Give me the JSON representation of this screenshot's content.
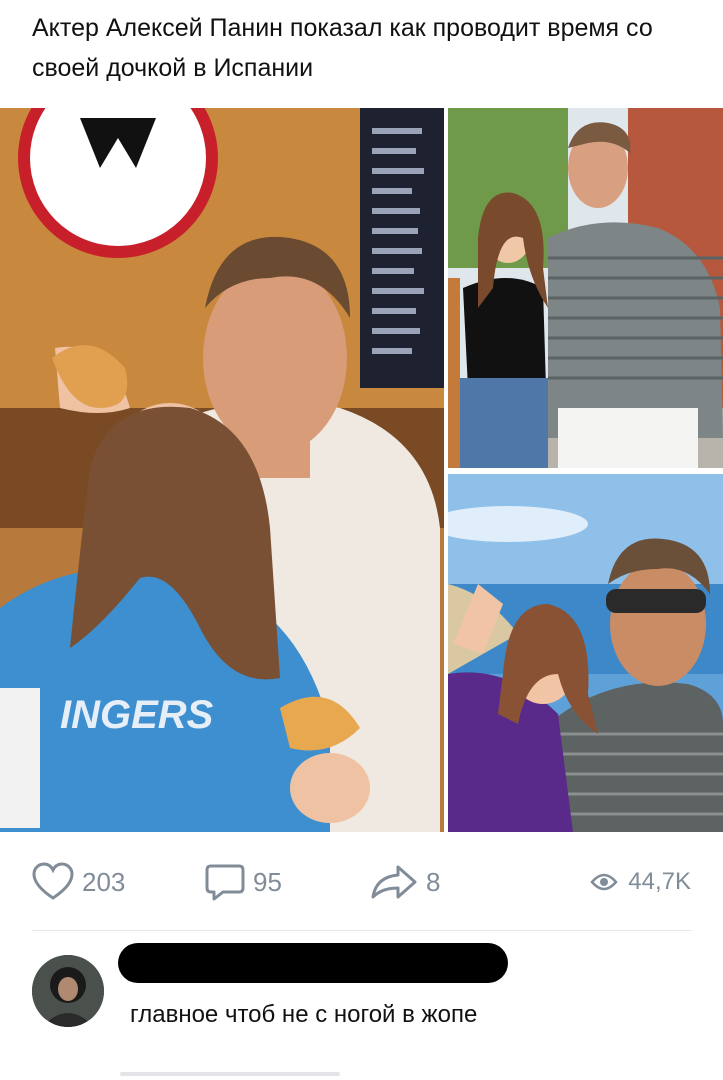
{
  "post": {
    "text": "Актер Алексей Панин показал как проводит время со своей дочкой в Испании"
  },
  "photos": [
    {
      "name": "main-photo",
      "hoodie_text": "INGERS"
    },
    {
      "name": "top-right-photo"
    },
    {
      "name": "bottom-right-photo"
    }
  ],
  "actions": {
    "likes": "203",
    "comments": "95",
    "shares": "8",
    "views": "44,7K",
    "icons": [
      "heart-icon",
      "comment-icon",
      "share-icon",
      "eye-icon"
    ]
  },
  "comment": {
    "text": "главное чтоб не с ногой в жопе"
  },
  "colors": {
    "icon_gray": "#818c99",
    "divider": "#e7e8ec",
    "censor": "#000000"
  }
}
